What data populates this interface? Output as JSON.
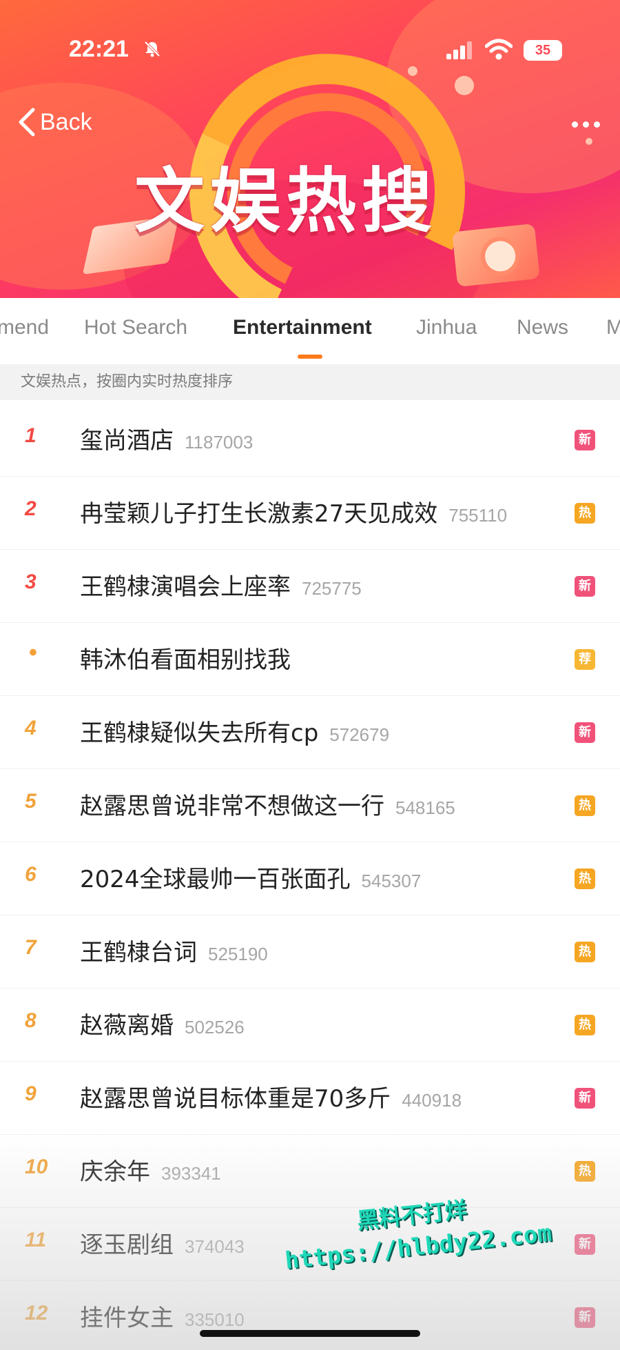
{
  "status_bar": {
    "time": "22:21",
    "battery": "35"
  },
  "header": {
    "back_label": "Back",
    "title": "文娱热搜"
  },
  "tabs": [
    {
      "label": "mend",
      "active": false
    },
    {
      "label": "Hot Search",
      "active": false
    },
    {
      "label": "Entertainment",
      "active": true
    },
    {
      "label": "Jinhua",
      "active": false
    },
    {
      "label": "News",
      "active": false
    },
    {
      "label": "M",
      "active": false
    }
  ],
  "hint": "文娱热点，按圈内实时热度排序",
  "badges": {
    "new": {
      "text": "新",
      "color": "#f0527a"
    },
    "hot": {
      "text": "热",
      "color": "#f5a623"
    },
    "rec": {
      "text": "荐",
      "color": "#f7b733"
    }
  },
  "items": [
    {
      "rank": "1",
      "topic": "玺尚酒店",
      "count": "1187003",
      "badge": "新",
      "badge_type": "new"
    },
    {
      "rank": "2",
      "topic": "冉莹颖儿子打生长激素27天见成效",
      "count": "755110",
      "badge": "热",
      "badge_type": "hot"
    },
    {
      "rank": "3",
      "topic": "王鹤棣演唱会上座率",
      "count": "725775",
      "badge": "新",
      "badge_type": "new"
    },
    {
      "rank": "•",
      "topic": "韩沐伯看面相别找我",
      "count": "",
      "badge": "荐",
      "badge_type": "rec"
    },
    {
      "rank": "4",
      "topic": "王鹤棣疑似失去所有cp",
      "count": "572679",
      "badge": "新",
      "badge_type": "new"
    },
    {
      "rank": "5",
      "topic": "赵露思曾说非常不想做这一行",
      "count": "548165",
      "badge": "热",
      "badge_type": "hot"
    },
    {
      "rank": "6",
      "topic": "2024全球最帅一百张面孔",
      "count": "545307",
      "badge": "热",
      "badge_type": "hot"
    },
    {
      "rank": "7",
      "topic": "王鹤棣台词",
      "count": "525190",
      "badge": "热",
      "badge_type": "hot"
    },
    {
      "rank": "8",
      "topic": "赵薇离婚",
      "count": "502526",
      "badge": "热",
      "badge_type": "hot"
    },
    {
      "rank": "9",
      "topic": "赵露思曾说目标体重是70多斤",
      "count": "440918",
      "badge": "新",
      "badge_type": "new"
    },
    {
      "rank": "10",
      "topic": "庆余年",
      "count": "393341",
      "badge": "热",
      "badge_type": "hot"
    },
    {
      "rank": "11",
      "topic": "逐玉剧组",
      "count": "374043",
      "badge": "新",
      "badge_type": "new"
    },
    {
      "rank": "12",
      "topic": "挂件女主",
      "count": "335010",
      "badge": "新",
      "badge_type": "new"
    }
  ],
  "watermark": {
    "line1": "黑料不打烊",
    "line2": "https://hlbdy22.com"
  }
}
